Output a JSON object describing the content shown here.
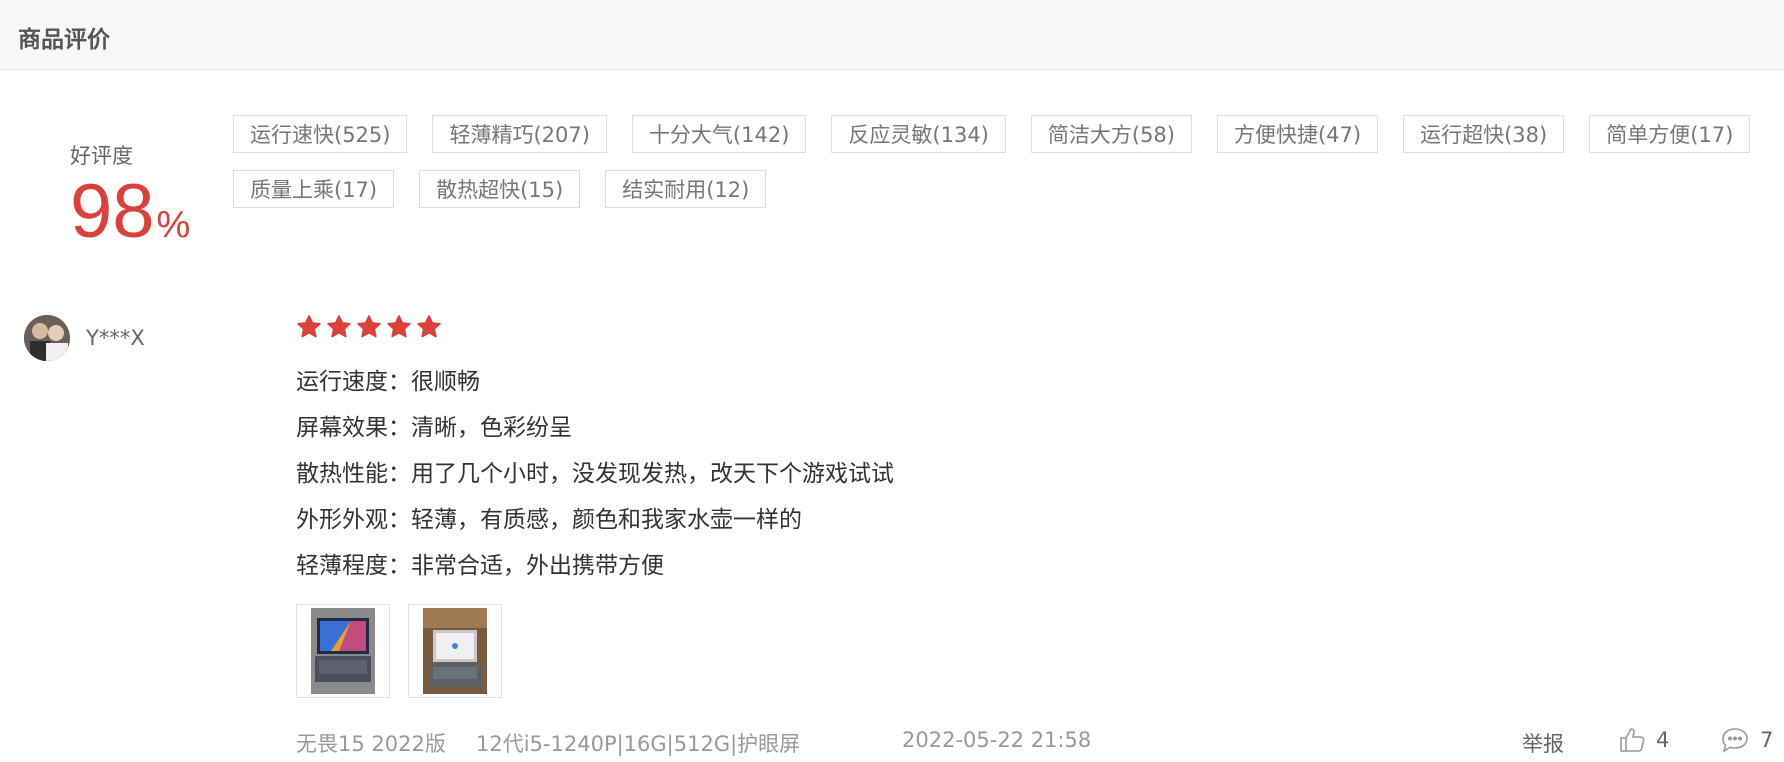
{
  "header": {
    "title": "商品评价"
  },
  "rating": {
    "label": "好评度",
    "value": "98",
    "unit": "%"
  },
  "tags": [
    "运行速快(525)",
    "轻薄精巧(207)",
    "十分大气(142)",
    "反应灵敏(134)",
    "简洁大方(58)",
    "方便快捷(47)",
    "运行超快(38)",
    "简单方便(17)",
    "质量上乘(17)",
    "散热超快(15)",
    "结实耐用(12)"
  ],
  "review": {
    "username": "Y***X",
    "stars": 5,
    "star_color": "#d9413b",
    "lines": [
      "运行速度：很顺畅",
      "屏幕效果：清晰，色彩纷呈",
      "散热性能：用了几个小时，没发现发热，改天下个游戏试试",
      "外形外观：轻薄，有质感，颜色和我家水壶一样的",
      "轻薄程度：非常合适，外出携带方便"
    ],
    "footer": {
      "model": "无畏15 2022版",
      "spec": "12代i5-1240P|16G|512G|护眼屏",
      "date": "2022-05-22 21:58",
      "report": "举报",
      "likes": "4",
      "comments": "7"
    }
  }
}
